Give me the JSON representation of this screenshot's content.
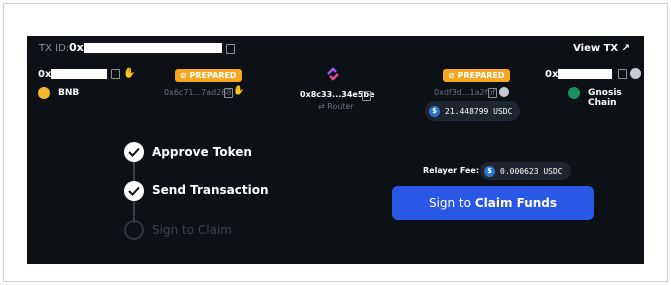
{
  "header": {
    "txid_label": "TX ID:",
    "txid_prefix": "0x",
    "view_tx": "View TX ↗"
  },
  "source": {
    "address_prefix": "0x",
    "chain": "BNB",
    "status": "PREPARED",
    "tx_hash": "0x6c71...7ad268"
  },
  "router": {
    "address": "0x8c33...34e5be",
    "label": "Router"
  },
  "destination": {
    "address_prefix": "0x",
    "chain": "Gnosis Chain",
    "status": "PREPARED",
    "tx_hash": "0xdf3d...1a2fbf",
    "amount": "21.448799 USDC"
  },
  "steps": [
    {
      "label": "Approve Token",
      "done": true
    },
    {
      "label": "Send Transaction",
      "done": true
    },
    {
      "label": "Sign to Claim",
      "done": false
    }
  ],
  "fee": {
    "label": "Relayer Fee:",
    "amount": "0.000623 USDC"
  },
  "claim": {
    "prefix": "Sign to",
    "action": "Claim Funds"
  },
  "colors": {
    "panel": "#0d1015",
    "badge": "#f5a623",
    "button": "#2b57e6",
    "usdc": "#2775ca"
  }
}
